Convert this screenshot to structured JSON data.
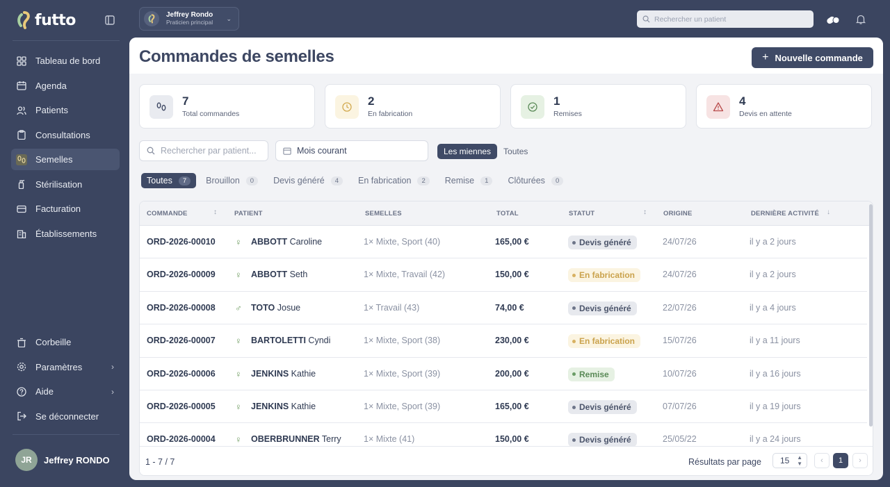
{
  "brand": {
    "name": "futto"
  },
  "sidebar": {
    "items": [
      {
        "label": "Tableau de bord",
        "icon": "dashboard-icon"
      },
      {
        "label": "Agenda",
        "icon": "calendar-icon"
      },
      {
        "label": "Patients",
        "icon": "users-icon"
      },
      {
        "label": "Consultations",
        "icon": "clipboard-icon"
      },
      {
        "label": "Semelles",
        "icon": "footprints-icon",
        "active": true
      },
      {
        "label": "Stérilisation",
        "icon": "spray-icon"
      },
      {
        "label": "Facturation",
        "icon": "credit-card-icon"
      },
      {
        "label": "Établissements",
        "icon": "building-icon"
      }
    ],
    "bottom_items": [
      {
        "label": "Corbeille",
        "icon": "trash-icon"
      },
      {
        "label": "Paramètres",
        "icon": "gear-icon"
      },
      {
        "label": "Aide",
        "icon": "help-icon"
      },
      {
        "label": "Se déconnecter",
        "icon": "logout-icon"
      }
    ],
    "user": {
      "initials": "JR",
      "name": "Jeffrey RONDO"
    }
  },
  "topbar": {
    "account_name": "Jeffrey Rondo",
    "account_role": "Praticien principal",
    "search_placeholder": "Rechercher un patient"
  },
  "page": {
    "title": "Commandes de semelles",
    "new_button": "Nouvelle commande"
  },
  "stats": [
    {
      "value": "7",
      "label": "Total commandes"
    },
    {
      "value": "2",
      "label": "En fabrication"
    },
    {
      "value": "1",
      "label": "Remises"
    },
    {
      "value": "4",
      "label": "Devis en attente"
    }
  ],
  "filters": {
    "search_placeholder": "Rechercher par patient...",
    "period": "Mois courant",
    "scope_mine": "Les miennes",
    "scope_all": "Toutes"
  },
  "tabs": [
    {
      "label": "Toutes",
      "count": "7"
    },
    {
      "label": "Brouillon",
      "count": "0"
    },
    {
      "label": "Devis généré",
      "count": "4"
    },
    {
      "label": "En fabrication",
      "count": "2"
    },
    {
      "label": "Remise",
      "count": "1"
    },
    {
      "label": "Clôturées",
      "count": "0"
    }
  ],
  "table": {
    "headers": {
      "commande": "COMMANDE",
      "patient": "PATIENT",
      "semelles": "SEMELLES",
      "total": "TOTAL",
      "statut": "STATUT",
      "origine": "ORIGINE",
      "activite": "DERNIÈRE ACTIVITÉ"
    },
    "rows": [
      {
        "ref": "ORD-2026-00010",
        "sex": "♀",
        "last": "ABBOTT",
        "first": "Caroline",
        "semelles": "1× Mixte, Sport (40)",
        "total": "165,00 €",
        "status": "Devis généré",
        "tone": "grey",
        "date": "24/07/26",
        "activity": "il y a 2 jours"
      },
      {
        "ref": "ORD-2026-00009",
        "sex": "♀",
        "last": "ABBOTT",
        "first": "Seth",
        "semelles": "1× Mixte, Travail (42)",
        "total": "150,00 €",
        "status": "En fabrication",
        "tone": "yellow",
        "date": "24/07/26",
        "activity": "il y a 2 jours"
      },
      {
        "ref": "ORD-2026-00008",
        "sex": "♂",
        "last": "TOTO",
        "first": "Josue",
        "semelles": "1× Travail (43)",
        "total": "74,00 €",
        "status": "Devis généré",
        "tone": "grey",
        "date": "22/07/26",
        "activity": "il y a 4 jours"
      },
      {
        "ref": "ORD-2026-00007",
        "sex": "♀",
        "last": "BARTOLETTI",
        "first": "Cyndi",
        "semelles": "1× Mixte, Sport (38)",
        "total": "230,00 €",
        "status": "En fabrication",
        "tone": "yellow",
        "date": "15/07/26",
        "activity": "il y a 11 jours"
      },
      {
        "ref": "ORD-2026-00006",
        "sex": "♀",
        "last": "JENKINS",
        "first": "Kathie",
        "semelles": "1× Mixte, Sport (39)",
        "total": "200,00 €",
        "status": "Remise",
        "tone": "green",
        "date": "10/07/26",
        "activity": "il y a 16 jours"
      },
      {
        "ref": "ORD-2026-00005",
        "sex": "♀",
        "last": "JENKINS",
        "first": "Kathie",
        "semelles": "1× Mixte, Sport (39)",
        "total": "165,00 €",
        "status": "Devis généré",
        "tone": "grey",
        "date": "07/07/26",
        "activity": "il y a 19 jours"
      },
      {
        "ref": "ORD-2026-00004",
        "sex": "♀",
        "last": "OBERBRUNNER",
        "first": "Terry",
        "semelles": "1× Mixte (41)",
        "total": "150,00 €",
        "status": "Devis généré",
        "tone": "grey",
        "date": "25/05/22",
        "activity": "il y a 24 jours"
      }
    ],
    "range": "1 - 7 / 7",
    "per_page_label": "Résultats par page",
    "per_page": "15",
    "current_page": "1"
  },
  "colors": {
    "sidebar_bg": "#3b4560",
    "accent": "#3f4a66",
    "status_grey": "#e7e9ee",
    "status_yellow": "#fbf4e1",
    "status_green": "#e6f1e3"
  }
}
